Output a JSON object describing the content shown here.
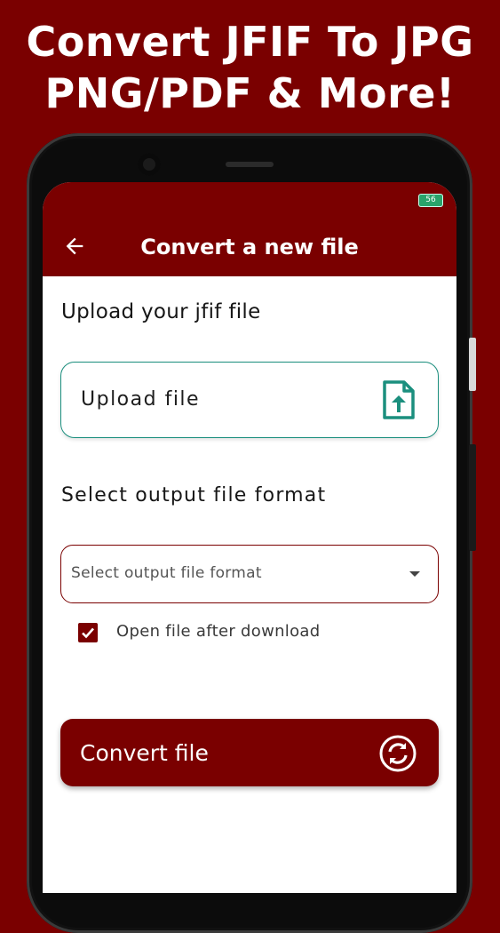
{
  "promo": {
    "line1": "Convert JFIF To JPG",
    "line2": "PNG/PDF & More!"
  },
  "status_bar": {
    "battery": "56"
  },
  "appbar": {
    "title": "Convert a new file",
    "back_icon": "arrow-left-icon"
  },
  "upload_section": {
    "heading": "Upload your jfif file",
    "button_label": "Upload file",
    "icon": "file-upload-icon"
  },
  "format_section": {
    "heading": "Select output file format",
    "select_placeholder": "Select output file format",
    "caret_icon": "caret-down-icon"
  },
  "options": {
    "open_after_download": {
      "label": "Open file after download",
      "checked": true
    }
  },
  "convert": {
    "button_label": "Convert file",
    "icon": "sync-icon"
  },
  "colors": {
    "brand": "#7a0000",
    "accent_teal": "#1b8f7e",
    "background": "#ffffff"
  }
}
